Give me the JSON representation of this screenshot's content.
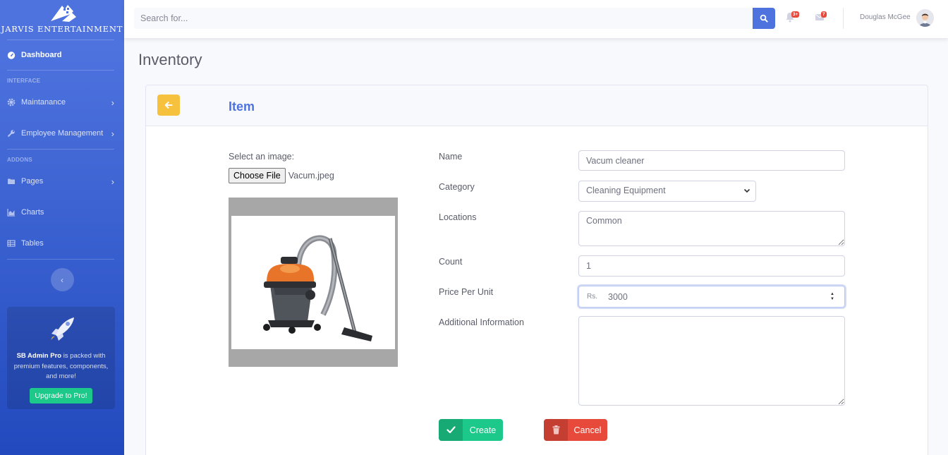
{
  "sidebar": {
    "brand": "JARVIS ENTERTAINMENT",
    "dashboard": "Dashboard",
    "heading_interface": "INTERFACE",
    "maintanance": "Maintanance",
    "employee_management": "Employee Management",
    "heading_addons": "ADDONS",
    "pages": "Pages",
    "charts": "Charts",
    "tables": "Tables",
    "promo_brand": "SB Admin Pro",
    "promo_text": " is packed with premium features, components, and more!",
    "promo_button": "Upgrade to Pro!"
  },
  "topbar": {
    "search_placeholder": "Search for...",
    "alerts_badge": "3+",
    "messages_badge": "7",
    "user_name": "Douglas McGee"
  },
  "page": {
    "title": "Inventory",
    "card_title": "Item"
  },
  "image": {
    "label": "Select an image:",
    "choose_button": "Choose File",
    "file_name": "Vacum.jpeg"
  },
  "form": {
    "name_label": "Name",
    "name_value": "Vacum cleaner",
    "category_label": "Category",
    "category_value": "Cleaning Equipment",
    "locations_label": "Locations",
    "locations_value": "Common",
    "count_label": "Count",
    "count_value": "1",
    "price_label": "Price Per Unit",
    "price_prefix": "Rs.",
    "price_value": "3000",
    "additional_label": "Additional Information",
    "additional_value": ""
  },
  "actions": {
    "create": "Create",
    "cancel": "Cancel"
  },
  "colors": {
    "primary": "#4e73df",
    "success": "#1cc88a",
    "danger": "#e74a3b",
    "warning": "#f6c23e"
  },
  "icons": [
    "tachometer-icon",
    "cog-icon",
    "wrench-icon",
    "folder-icon",
    "chart-area-icon",
    "table-icon",
    "rocket-icon",
    "search-icon",
    "bell-icon",
    "envelope-icon",
    "arrow-left-icon",
    "check-icon",
    "trash-icon"
  ]
}
